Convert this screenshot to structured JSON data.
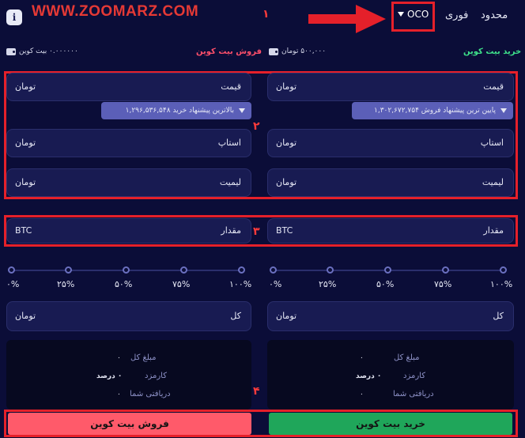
{
  "watermark": "WWW.ZOOMARZ.COM",
  "header": {
    "tabs": [
      {
        "label": "محدود"
      },
      {
        "label": "فوری"
      },
      {
        "label": "OCO"
      }
    ],
    "info_label": "i"
  },
  "annotations": [
    "۱",
    "۲",
    "۳",
    "۴"
  ],
  "buy": {
    "title": "خرید بیت کوین",
    "balance": "۵۰۰,۰۰۰ تومان",
    "price_label": "قیمت",
    "price_unit": "تومان",
    "price_hint": "پایین ترین پیشنهاد فروش ۱,۳۰۲,۶۷۲,۷۵۴",
    "stop_label": "استاپ",
    "stop_unit": "تومان",
    "limit_label": "لیمیت",
    "limit_unit": "تومان",
    "amount_label": "مقدار",
    "amount_unit": "BTC",
    "total_label": "کل",
    "total_unit": "تومان",
    "summary": {
      "total_amount_label": "مبلغ کل",
      "total_amount_value": "۰",
      "fee_label": "کارمزد",
      "fee_value": "۰ درصد",
      "receive_label": "دریافتی شما",
      "receive_value": "۰"
    },
    "button": "خرید بیت کوین"
  },
  "sell": {
    "title": "فروش بیت کوین",
    "balance": "۰.۰۰۰۰۰۰ بیت کوین",
    "price_label": "قیمت",
    "price_unit": "تومان",
    "price_hint": "بالاترین پیشنهاد خرید ۱,۲۹۶,۵۳۶,۵۴۸",
    "stop_label": "استاپ",
    "stop_unit": "تومان",
    "limit_label": "لیمیت",
    "limit_unit": "تومان",
    "amount_label": "مقدار",
    "amount_unit": "BTC",
    "total_label": "کل",
    "total_unit": "تومان",
    "summary": {
      "total_amount_label": "مبلغ کل",
      "total_amount_value": "۰",
      "fee_label": "کارمزد",
      "fee_value": "۰ درصد",
      "receive_label": "دریافتی شما",
      "receive_value": "۰"
    },
    "button": "فروش بیت کوین"
  },
  "percent_labels": [
    "۰%",
    "۲۵%",
    "۵۰%",
    "۷۵%",
    "۱۰۰%"
  ],
  "colors": {
    "background": "#0b0d38",
    "buy": "#1fa65a",
    "sell": "#ff5a6a",
    "highlight": "#e5202a",
    "field": "#181b52",
    "hint_pill": "#5b5fb8"
  }
}
